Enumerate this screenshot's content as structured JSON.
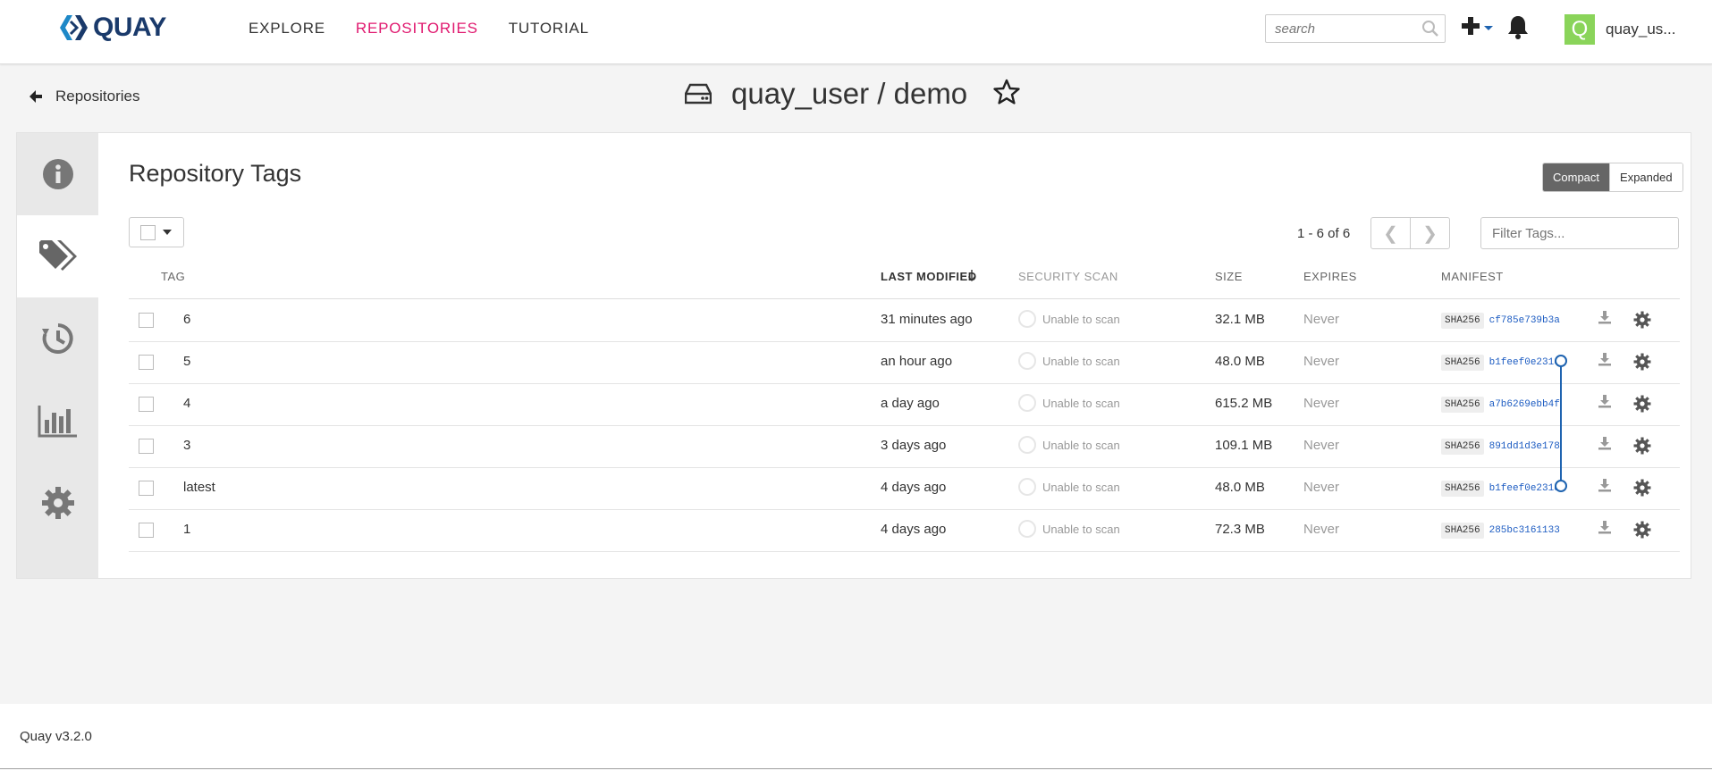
{
  "brand": {
    "logo_text": "QUAY",
    "logo_icon": "quay-logo-icon"
  },
  "nav": {
    "explore": "EXPLORE",
    "repositories": "REPOSITORIES",
    "tutorial": "TUTORIAL"
  },
  "search": {
    "placeholder": "search"
  },
  "user": {
    "avatar_letter": "Q",
    "name": "quay_us...",
    "avatar_color": "#8ad45a"
  },
  "breadcrumb": {
    "back_label": "Repositories"
  },
  "repo": {
    "title": "quay_user / demo"
  },
  "tags_panel": {
    "title": "Repository Tags",
    "view_compact": "Compact",
    "view_expanded": "Expanded",
    "pagination_count": "1 - 6 of 6",
    "filter_placeholder": "Filter Tags...",
    "columns": {
      "tag": "TAG",
      "last_modified": "LAST MODIFIED",
      "security_scan": "SECURITY SCAN",
      "size": "SIZE",
      "expires": "EXPIRES",
      "manifest": "MANIFEST"
    },
    "rows": [
      {
        "tag": "6",
        "modified": "31 minutes ago",
        "scan": "Unable to scan",
        "size": "32.1 MB",
        "expires": "Never",
        "digest_type": "SHA256",
        "digest": "cf785e739b3a"
      },
      {
        "tag": "5",
        "modified": "an hour ago",
        "scan": "Unable to scan",
        "size": "48.0 MB",
        "expires": "Never",
        "digest_type": "SHA256",
        "digest": "b1feef0e231d"
      },
      {
        "tag": "4",
        "modified": "a day ago",
        "scan": "Unable to scan",
        "size": "615.2 MB",
        "expires": "Never",
        "digest_type": "SHA256",
        "digest": "a7b6269ebb4f"
      },
      {
        "tag": "3",
        "modified": "3 days ago",
        "scan": "Unable to scan",
        "size": "109.1 MB",
        "expires": "Never",
        "digest_type": "SHA256",
        "digest": "891dd1d3e178"
      },
      {
        "tag": "latest",
        "modified": "4 days ago",
        "scan": "Unable to scan",
        "size": "48.0 MB",
        "expires": "Never",
        "digest_type": "SHA256",
        "digest": "b1feef0e231d"
      },
      {
        "tag": "1",
        "modified": "4 days ago",
        "scan": "Unable to scan",
        "size": "72.3 MB",
        "expires": "Never",
        "digest_type": "SHA256",
        "digest": "285bc3161133"
      }
    ]
  },
  "side_tabs": [
    "info-icon",
    "tags-icon",
    "history-icon",
    "usage-chart-icon",
    "settings-gear-icon"
  ],
  "colors": {
    "accent": "#e0196f",
    "link": "#1d5cc2",
    "brand": "#1a3a6b"
  },
  "footer": {
    "version": "Quay v3.2.0"
  }
}
